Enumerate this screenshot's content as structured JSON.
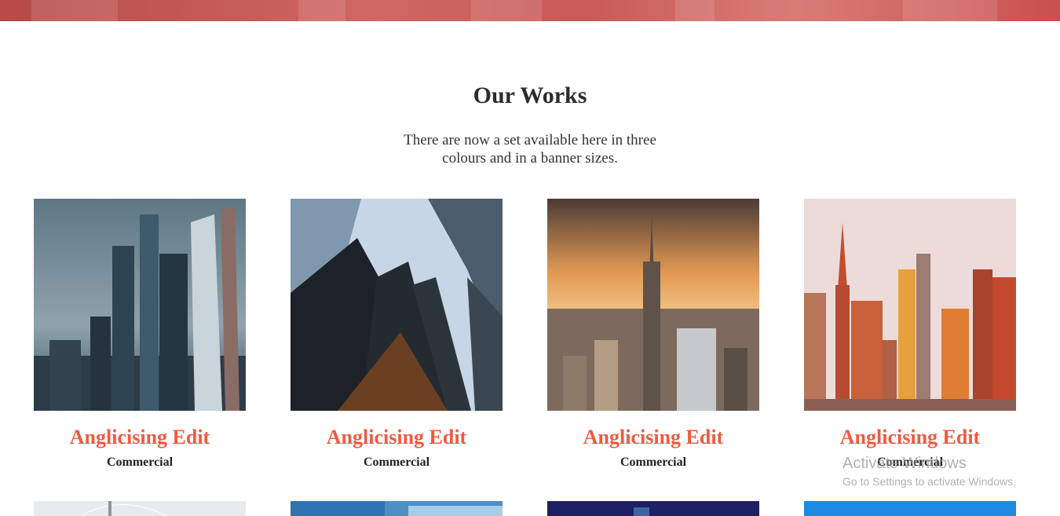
{
  "section": {
    "title": "Our Works",
    "subtitle": "There are now a set available here in three colours and in a banner sizes."
  },
  "works": [
    {
      "title": "Anglicising Edit",
      "category": "Commercial",
      "image": "skyscrapers-dusk-photo"
    },
    {
      "title": "Anglicising Edit",
      "category": "Commercial",
      "image": "glass-towers-looking-up-photo"
    },
    {
      "title": "Anglicising Edit",
      "category": "Commercial",
      "image": "empire-state-sunset-photo"
    },
    {
      "title": "Anglicising Edit",
      "category": "Commercial",
      "image": "city-skyline-sunset-photo"
    }
  ],
  "second_row_images": [
    "city-sky-photo",
    "blue-glass-tower-photo",
    "night-city-photo",
    "blue-sky-photo"
  ],
  "os_watermark": {
    "line1": "Activate Windows",
    "line2": "Go to Settings to activate Windows."
  },
  "colors": {
    "accent": "#f05a3e",
    "banner": "#c85a57",
    "heading": "#2b2b2b"
  }
}
